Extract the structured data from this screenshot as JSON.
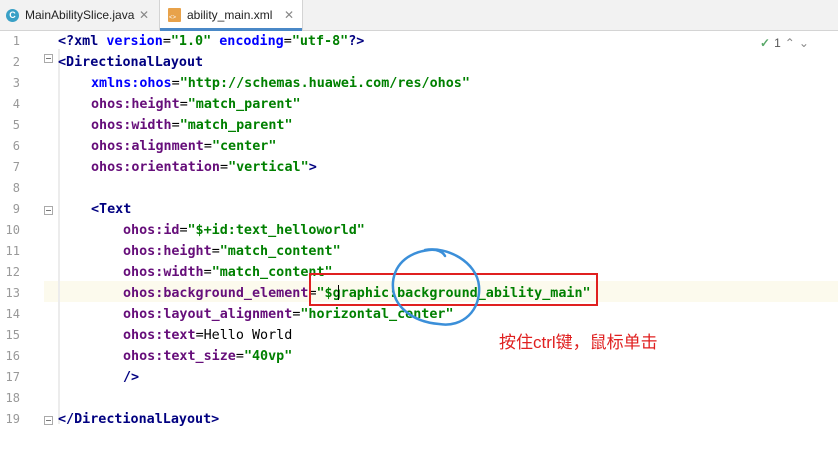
{
  "tabs": [
    {
      "icon": "C",
      "label": "MainAbilitySlice.java",
      "close": "✕"
    },
    {
      "icon": "xml",
      "label": "ability_main.xml",
      "close": "✕"
    }
  ],
  "inspection": {
    "count": "1"
  },
  "lines": [
    {
      "n": "1"
    },
    {
      "n": "2"
    },
    {
      "n": "3"
    },
    {
      "n": "4"
    },
    {
      "n": "5"
    },
    {
      "n": "6"
    },
    {
      "n": "7"
    },
    {
      "n": "8"
    },
    {
      "n": "9"
    },
    {
      "n": "10"
    },
    {
      "n": "11"
    },
    {
      "n": "12"
    },
    {
      "n": "13"
    },
    {
      "n": "14"
    },
    {
      "n": "15"
    },
    {
      "n": "16"
    },
    {
      "n": "17"
    },
    {
      "n": "18"
    },
    {
      "n": "19"
    }
  ],
  "code": {
    "l1_a": "<?xml",
    "l1_b": " version",
    "l1_c": "=",
    "l1_d": "\"1.0\"",
    "l1_e": " encoding",
    "l1_f": "=",
    "l1_g": "\"utf-8\"",
    "l1_h": "?>",
    "l2_a": "<DirectionalLayout",
    "l3_a": "xmlns:ohos",
    "l3_b": "=",
    "l3_c": "\"http://schemas.huawei.com/res/ohos\"",
    "l4_a": "ohos:",
    "l4_b": "height",
    "l4_c": "=",
    "l4_d": "\"match_parent\"",
    "l5_a": "ohos:",
    "l5_b": "width",
    "l5_c": "=",
    "l5_d": "\"match_parent\"",
    "l6_a": "ohos:",
    "l6_b": "alignment",
    "l6_c": "=",
    "l6_d": "\"center\"",
    "l7_a": "ohos:",
    "l7_b": "orientation",
    "l7_c": "=",
    "l7_d": "\"vertical\"",
    "l7_e": ">",
    "l9_a": "<Text",
    "l10_a": "ohos:",
    "l10_b": "id",
    "l10_c": "=",
    "l10_d": "\"$+id:text_helloworld\"",
    "l11_a": "ohos:",
    "l11_b": "height",
    "l11_c": "=",
    "l11_d": "\"match_content\"",
    "l12_a": "ohos:",
    "l12_b": "width",
    "l12_c": "=",
    "l12_d": "\"match_content\"",
    "l13_a": "ohos:",
    "l13_b": "background_element",
    "l13_c": "=",
    "l13_d": "\"$graphic:background_ability_main\"",
    "l14_a": "ohos:",
    "l14_b": "layout_alignment",
    "l14_c": "=",
    "l14_d": "\"horizontal_center\"",
    "l15_a": "ohos:",
    "l15_b": "text",
    "l15_c": "=",
    "l15_d": "Hello World",
    "l16_a": "ohos:",
    "l16_b": "text_size",
    "l16_c": "=",
    "l16_d": "\"40vp\"",
    "l17_a": "/>",
    "l19_a": "</DirectionalLayout>"
  },
  "annotation": {
    "note": "按住ctrl键，鼠标单击",
    "box_color": "#e02020",
    "circle_color": "#3b8fd9"
  }
}
